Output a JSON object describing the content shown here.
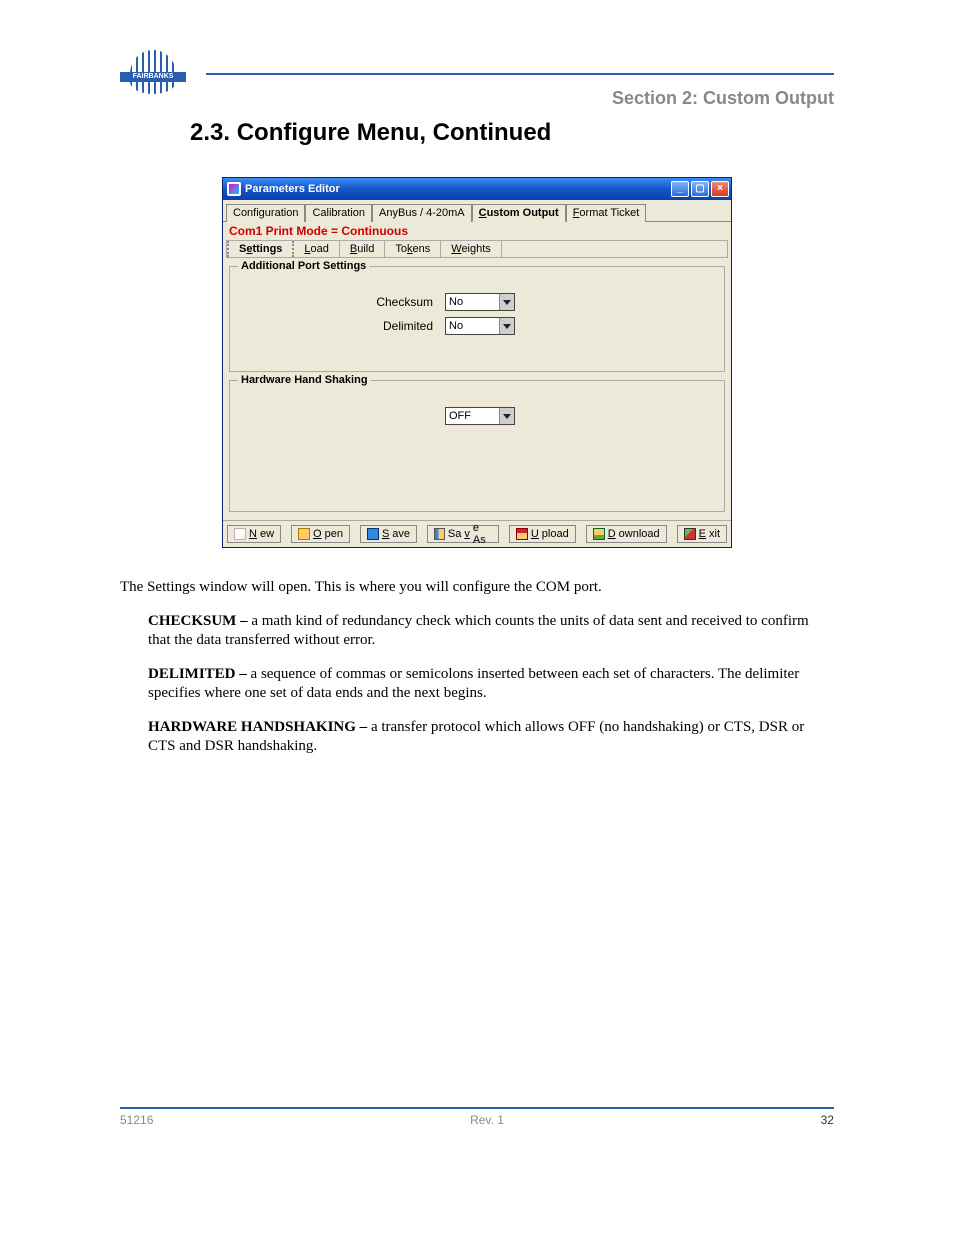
{
  "header": {
    "logo_text": "FAIRBANKS",
    "section_title": "2.3.  Configure Menu, Continued",
    "section_right_heading": "Section 2:  Custom Output"
  },
  "window": {
    "title": "Parameters Editor",
    "title_buttons": {
      "min": "_",
      "max": "▢",
      "close": "×"
    },
    "tabs": [
      {
        "label": "Configuration",
        "active": false
      },
      {
        "label": "Calibration",
        "active": false
      },
      {
        "label": "AnyBus / 4-20mA",
        "active": false
      },
      {
        "label_pre": "",
        "label_u": "C",
        "label_post": "ustom Output",
        "active": true
      },
      {
        "label_pre": "",
        "label_u": "F",
        "label_post": "ormat Ticket",
        "active": false
      }
    ],
    "mode_line": "Com1 Print Mode = Continuous",
    "subtabs": [
      {
        "pre": "S",
        "u": "e",
        "post": "ttings"
      },
      {
        "pre": "",
        "u": "L",
        "post": "oad"
      },
      {
        "pre": "",
        "u": "B",
        "post": "uild"
      },
      {
        "pre": "To",
        "u": "k",
        "post": "ens"
      },
      {
        "pre": "",
        "u": "W",
        "post": "eights"
      }
    ],
    "group_additional": {
      "title": "Additional Port Settings",
      "fields": [
        {
          "label": "Checksum",
          "value": "No"
        },
        {
          "label": "Delimited",
          "value": "No"
        }
      ]
    },
    "group_hhs": {
      "title": "Hardware Hand Shaking",
      "field": {
        "value": "OFF"
      }
    },
    "buttons": [
      {
        "u": "N",
        "post": "ew",
        "icon": "ic-new",
        "name": "new-button"
      },
      {
        "u": "O",
        "post": "pen",
        "icon": "ic-open",
        "name": "open-button"
      },
      {
        "u": "S",
        "post": "ave",
        "icon": "ic-save",
        "name": "save-button"
      },
      {
        "pre": "Sa",
        "u": "v",
        "post": "e As",
        "icon": "ic-saveas",
        "name": "save-as-button"
      },
      {
        "u": "U",
        "post": "pload",
        "icon": "ic-upload",
        "name": "upload-button"
      },
      {
        "u": "D",
        "post": "ownload",
        "icon": "ic-download",
        "name": "download-button"
      },
      {
        "u": "E",
        "post": "xit",
        "icon": "ic-exit",
        "name": "exit-button"
      }
    ]
  },
  "body": {
    "para1": "The Settings window will open. This is where you will configure the COM port.",
    "para2_label": "CHECKSUM – ",
    "para2": "a math kind of redundancy check which counts the units of data sent and received to confirm that the data transferred without error.",
    "para3_label": "DELIMITED – ",
    "para3": "a sequence of commas or semicolons inserted between each set of characters. The delimiter specifies where one set of data ends and the next begins.",
    "para4_label": "HARDWARE HANDSHAKING – ",
    "para4": "a transfer protocol which allows OFF (no handshaking) or CTS, DSR or CTS and DSR handshaking."
  },
  "footer": {
    "left": "51216",
    "center_pre": "Rev. ",
    "center_post": "1",
    "right": "32"
  }
}
